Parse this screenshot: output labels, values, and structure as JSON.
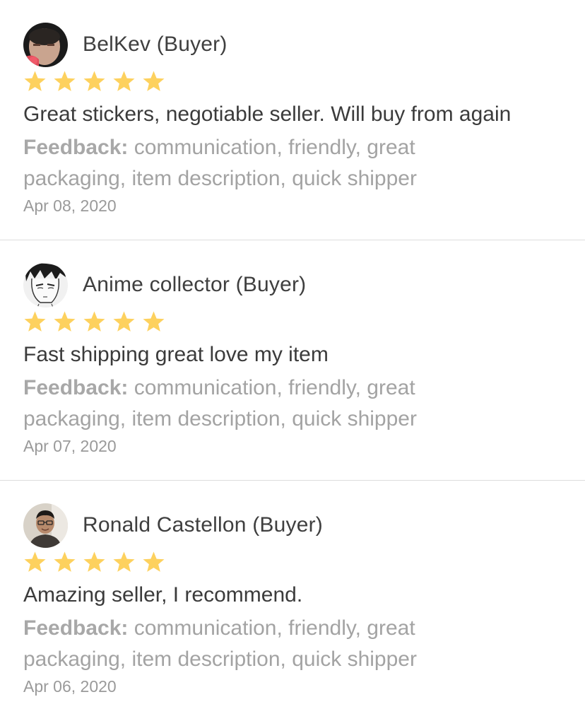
{
  "reviews": [
    {
      "reviewer": "BelKev (Buyer)",
      "avatar_icon": "user-photo-avatar",
      "rating": 5,
      "rating_max": 5,
      "comment": "Great stickers, negotiable seller. Will buy from again",
      "feedback_label": "Feedback:",
      "feedback_tags": " communication, friendly, great packaging, item description, quick shipper",
      "date": "Apr 08, 2020"
    },
    {
      "reviewer": "Anime collector (Buyer)",
      "avatar_icon": "anime-drawing-avatar",
      "rating": 5,
      "rating_max": 5,
      "comment": "Fast shipping great love my item",
      "feedback_label": "Feedback:",
      "feedback_tags": " communication, friendly, great packaging, item description, quick shipper",
      "date": "Apr 07, 2020"
    },
    {
      "reviewer": "Ronald Castellon (Buyer)",
      "avatar_icon": "user-photo-avatar",
      "rating": 5,
      "rating_max": 5,
      "comment": "Amazing seller, I recommend.",
      "feedback_label": "Feedback:",
      "feedback_tags": " communication, friendly, great packaging, item description, quick shipper",
      "date": "Apr 06, 2020"
    }
  ],
  "colors": {
    "star": "#fdd15e",
    "text_primary": "#3d3d3d",
    "text_muted": "#a3a3a3",
    "divider": "#dcdcdc"
  }
}
